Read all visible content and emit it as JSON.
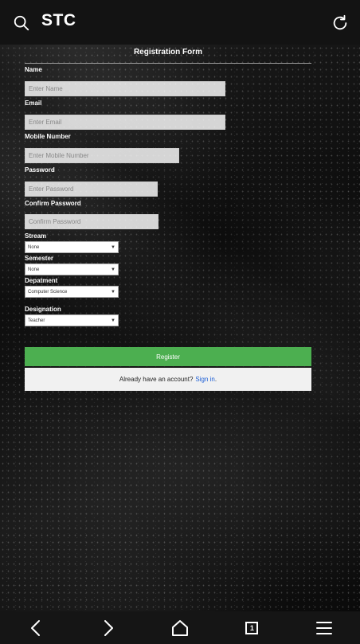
{
  "browser": {
    "title": "STC",
    "tab_count": "1"
  },
  "form": {
    "title": "Registration Form",
    "name": {
      "label": "Name",
      "placeholder": "Enter Name"
    },
    "email": {
      "label": "Email",
      "placeholder": "Enter Email"
    },
    "mobile": {
      "label": "Mobile Number",
      "placeholder": "Enter Mobile Number"
    },
    "password": {
      "label": "Password",
      "placeholder": "Enter Password"
    },
    "confirm": {
      "label": "Confirm Password",
      "placeholder": "Confirm Password"
    },
    "stream": {
      "label": "Stream",
      "value": "None"
    },
    "semester": {
      "label": "Semester",
      "value": "None"
    },
    "department": {
      "label": "Depatment",
      "value": "Computer Science"
    },
    "designation": {
      "label": "Designation",
      "value": "Teacher"
    },
    "register_label": "Register",
    "signin_prompt": "Already have an account?",
    "signin_link": "Sign in",
    "signin_period": "."
  },
  "colors": {
    "register": "#4caf50",
    "link": "#1e5fd6"
  }
}
